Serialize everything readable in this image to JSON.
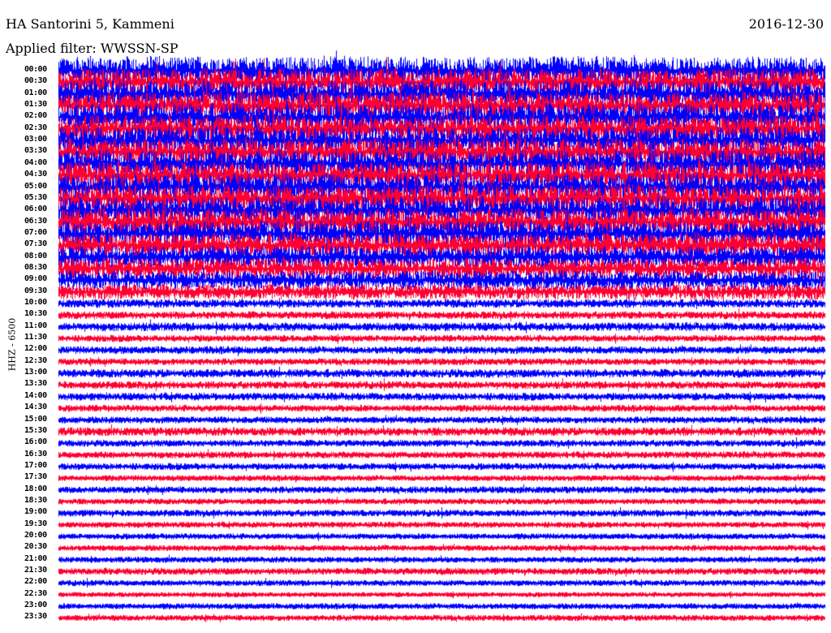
{
  "header": {
    "station": "HA Santorini 5, Kammeni",
    "filter": "Applied filter: WWSSN-SP",
    "date": "2016-12-30"
  },
  "chart_data": {
    "type": "line",
    "title": "HA Santorini 5, Kammeni",
    "ylabel": "HHZ - 6500",
    "row_labels": [
      "00:00",
      "00:30",
      "01:00",
      "01:30",
      "02:00",
      "02:30",
      "03:00",
      "03:30",
      "04:00",
      "04:30",
      "05:00",
      "05:30",
      "06:00",
      "06:30",
      "07:00",
      "07:30",
      "08:00",
      "08:30",
      "09:00",
      "09:30",
      "10:00",
      "10:30",
      "11:00",
      "11:30",
      "12:00",
      "12:30",
      "13:00",
      "13:30",
      "14:00",
      "14:30",
      "15:00",
      "15:30",
      "16:00",
      "16:30",
      "17:00",
      "17:30",
      "18:00",
      "18:30",
      "19:00",
      "19:30",
      "20:00",
      "20:30",
      "21:00",
      "21:30",
      "22:00",
      "22:30",
      "23:00",
      "23:30"
    ],
    "relative_amplitude": [
      3.0,
      3.0,
      3.0,
      3.0,
      3.0,
      3.0,
      3.0,
      3.0,
      3.0,
      3.0,
      3.0,
      3.0,
      3.0,
      3.0,
      2.8,
      2.6,
      2.4,
      2.2,
      2.0,
      1.6,
      0.8,
      0.7,
      0.8,
      0.6,
      0.7,
      0.6,
      0.8,
      0.7,
      0.7,
      0.6,
      0.6,
      0.8,
      0.6,
      0.6,
      0.6,
      0.5,
      0.6,
      0.5,
      0.6,
      0.5,
      0.5,
      0.5,
      0.5,
      0.6,
      0.5,
      0.4,
      0.5,
      0.5
    ],
    "series_colors": [
      "#0000ff",
      "#ff0033"
    ],
    "minutes_per_row": 30
  }
}
